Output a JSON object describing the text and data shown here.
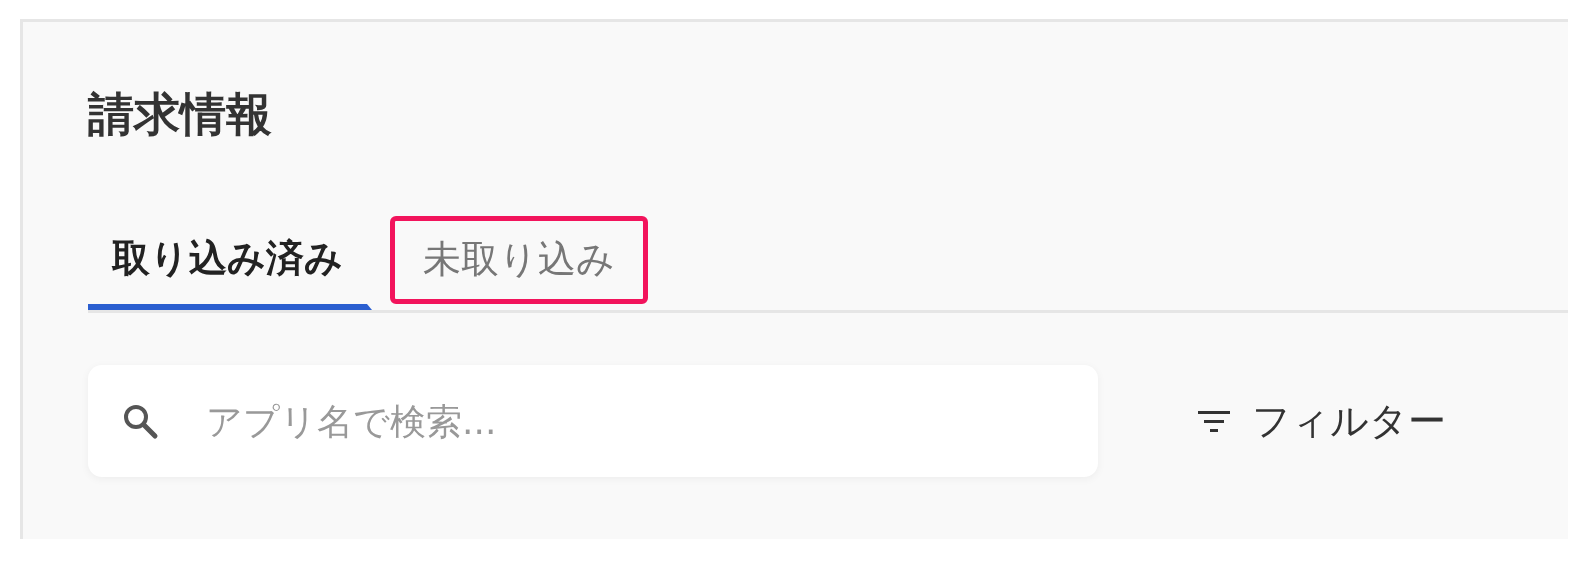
{
  "title": "請求情報",
  "tabs": [
    {
      "label": "取り込み済み",
      "selected": true,
      "highlighted": false
    },
    {
      "label": "未取り込み",
      "selected": false,
      "highlighted": true
    }
  ],
  "search": {
    "placeholder": "アプリ名で検索..."
  },
  "filter_button": {
    "label": "フィルター"
  }
}
